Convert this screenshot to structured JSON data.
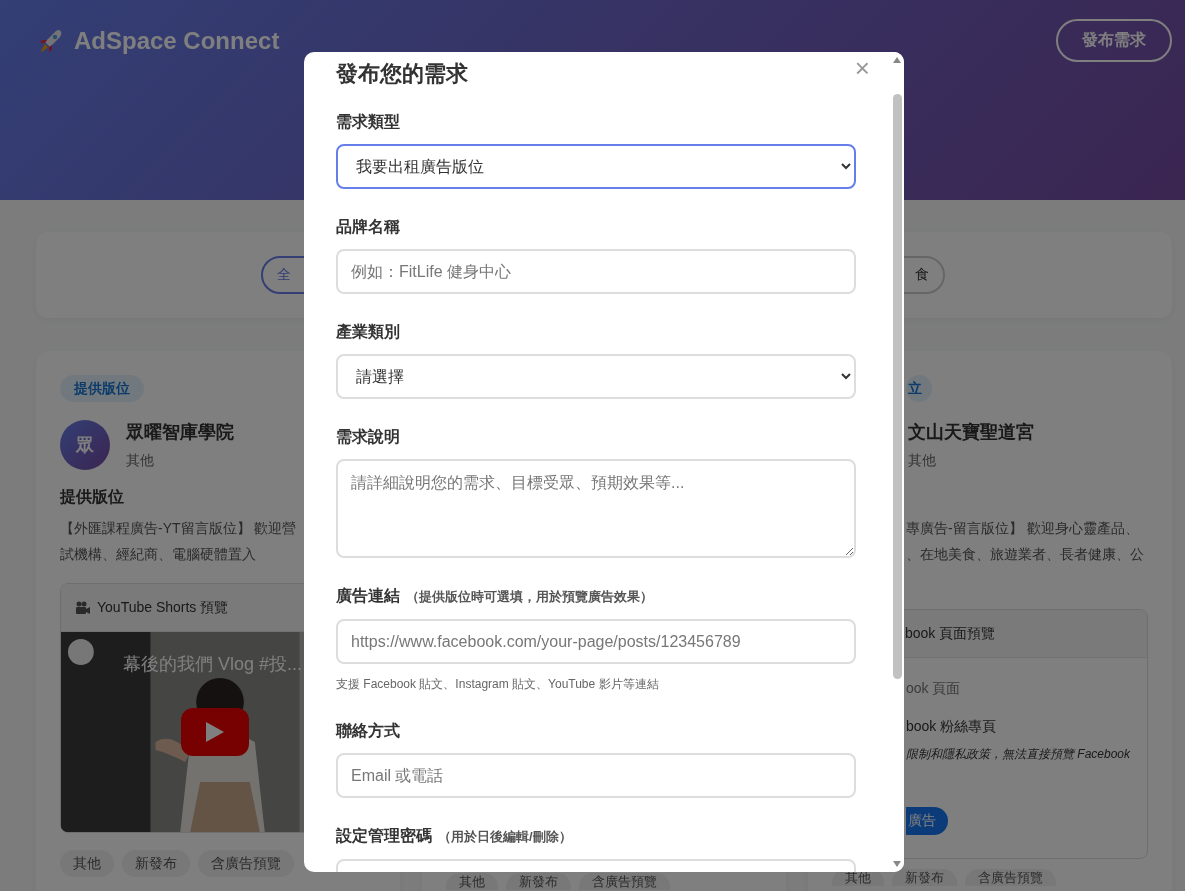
{
  "header": {
    "logo_text": "AdSpace Connect",
    "post_button": "發布需求"
  },
  "filter_bar": {
    "pills": [
      {
        "label": "全",
        "selected": true
      },
      {
        "label": "食",
        "selected": false
      }
    ]
  },
  "cards": [
    {
      "badge": "提供版位",
      "avatar": "眾",
      "name": "眾曜智庫學院",
      "category": "其他",
      "heading": "提供版位",
      "description_lines": [
        "【外匯課程廣告-YT留言版位】 歡迎營",
        "試機構、經紀商、電腦硬體置入"
      ],
      "preview": {
        "kind": "youtube",
        "title": "YouTube Shorts 預覽",
        "video_title": "幕後的我們 Vlog #投..."
      },
      "tags": [
        "其他",
        "新發布",
        "含廣告預覽"
      ]
    },
    {
      "tags": [
        "其他",
        "新發布",
        "含廣告預覽"
      ]
    },
    {
      "badge": "立",
      "name": "文山天寶聖道宮",
      "category": "其他",
      "description_lines": [
        "專廣告-留言版位】 歡迎身心靈產品、",
        "、在地美食、旅遊業者、長者健康、公"
      ],
      "preview": {
        "kind": "facebook",
        "title": "book 頁面預覽",
        "lines": [
          "ook 頁面",
          "book 粉絲專頁"
        ],
        "note": "限制和隱私政策，無法直接預覽 Facebook",
        "button": "廣告"
      },
      "tags": [
        "其他",
        "新發布",
        "含廣告預覽"
      ]
    }
  ],
  "modal": {
    "title": "發布您的需求",
    "close": "×",
    "fields": [
      {
        "kind": "select",
        "label": "需求類型",
        "value": "我要出租廣告版位",
        "focused": true
      },
      {
        "kind": "input",
        "label": "品牌名稱",
        "placeholder": "例如：FitLife 健身中心"
      },
      {
        "kind": "select",
        "label": "產業類別",
        "value": "請選擇",
        "focused": false
      },
      {
        "kind": "textarea",
        "label": "需求說明",
        "placeholder": "請詳細說明您的需求、目標受眾、預期效果等..."
      },
      {
        "kind": "input",
        "label": "廣告連結",
        "hint": "（提供版位時可選填，用於預覽廣告效果）",
        "placeholder": "https://www.facebook.com/your-page/posts/123456789",
        "help": "支援 Facebook 貼文、Instagram 貼文、YouTube 影片等連結"
      },
      {
        "kind": "input",
        "label": "聯絡方式",
        "placeholder": "Email 或電話"
      },
      {
        "kind": "input",
        "label": "設定管理密碼",
        "hint": "（用於日後編輯/刪除）"
      }
    ]
  }
}
